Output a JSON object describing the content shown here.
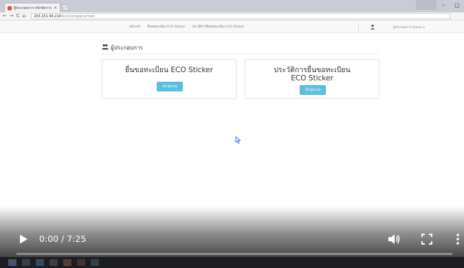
{
  "browser": {
    "tab_title": "ผู้ประกอบการ หน้าจัดการ",
    "tab_close": "×",
    "url_host": "203.151.94.214",
    "url_path": "/eco/company/main",
    "nav_back": "←",
    "nav_forward": "→",
    "nav_reload": "C",
    "nav_home": "⌂"
  },
  "navbar": {
    "links": [
      "หน้าแรก",
      "ยื่นขอทะเบียน ECO Sticker",
      "ประวัติการยื่นขอทะเบียน ECO Sticker"
    ],
    "user_name": "ผู้ประกอบการ Admin ▾"
  },
  "page": {
    "title": "ผู้ประกอบการ",
    "cards": [
      {
        "title": "ยื่นขอทะเบียน ECO Sticker",
        "button": "เข้าสู่ระบบ"
      },
      {
        "title": "ประวัติการยื่นขอทะเบียน ECO Sticker",
        "button": "เข้าสู่ระบบ"
      }
    ]
  },
  "video": {
    "time": "0:00 / 7:25",
    "progress_fraction": 0.0
  },
  "colors": {
    "button_info": "#5bc0de",
    "navbar_bg": "#f8f8f8",
    "taskbar_bg": "#1b1d22"
  },
  "icons": {
    "page_title": "users-icon",
    "navbar_user": "user-icon",
    "play": "play-icon",
    "volume": "volume-icon",
    "fullscreen": "fullscreen-icon",
    "more": "more-vertical-icon"
  }
}
